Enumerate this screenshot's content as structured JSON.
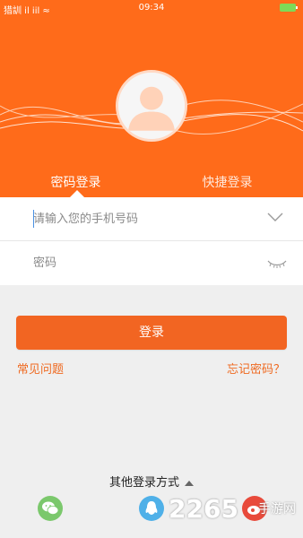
{
  "status_bar": {
    "carrier": "猎訓 il ⅰil ≈",
    "time": "09:34",
    "battery_color": "#7ed957"
  },
  "header": {
    "bg_color": "#ff6b1a",
    "tabs": [
      {
        "label": "密码登录",
        "active": true
      },
      {
        "label": "快捷登录",
        "active": false
      }
    ]
  },
  "form": {
    "phone_placeholder": "请输入您的手机号码",
    "password_placeholder": "密码",
    "chevron_icon": "chevron-down-icon",
    "eye_icon": "eye-closed-icon"
  },
  "actions": {
    "login_label": "登录",
    "faq_label": "常见问题",
    "forgot_label": "忘记密码？",
    "accent_color": "#f26522"
  },
  "other_login": {
    "label": "其他登录方式",
    "icons": [
      "wechat-icon",
      "qq-icon",
      "weibo-icon"
    ]
  },
  "watermark": {
    "number": "2265",
    "text": "手游网"
  }
}
